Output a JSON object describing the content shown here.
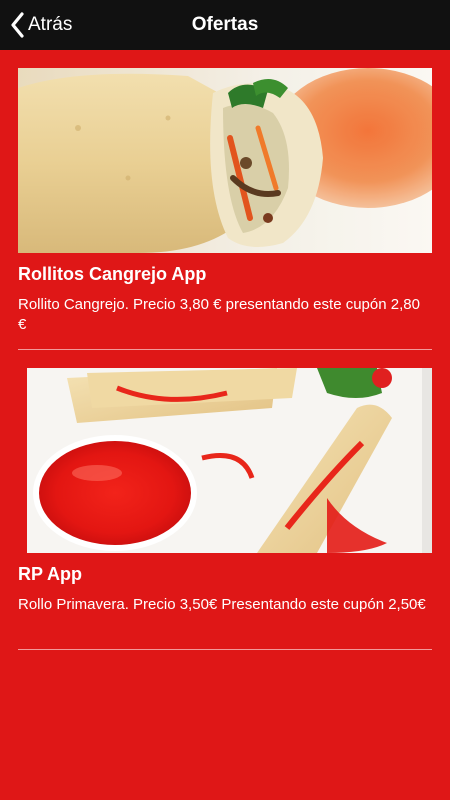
{
  "header": {
    "back_label": "Atrás",
    "title": "Ofertas"
  },
  "offers": [
    {
      "title": "Rollitos Cangrejo App",
      "description": "Rollito Cangrejo. Precio 3,80 € presentando este cupón 2,80 €"
    },
    {
      "title": "RP App",
      "description": "Rollo Primavera. Precio 3,50€ Presentando este cupón 2,50€"
    }
  ],
  "colors": {
    "background": "#df1717",
    "topbar": "#111111",
    "text": "#ffffff"
  },
  "icons": {
    "back": "chevron-left-icon"
  }
}
